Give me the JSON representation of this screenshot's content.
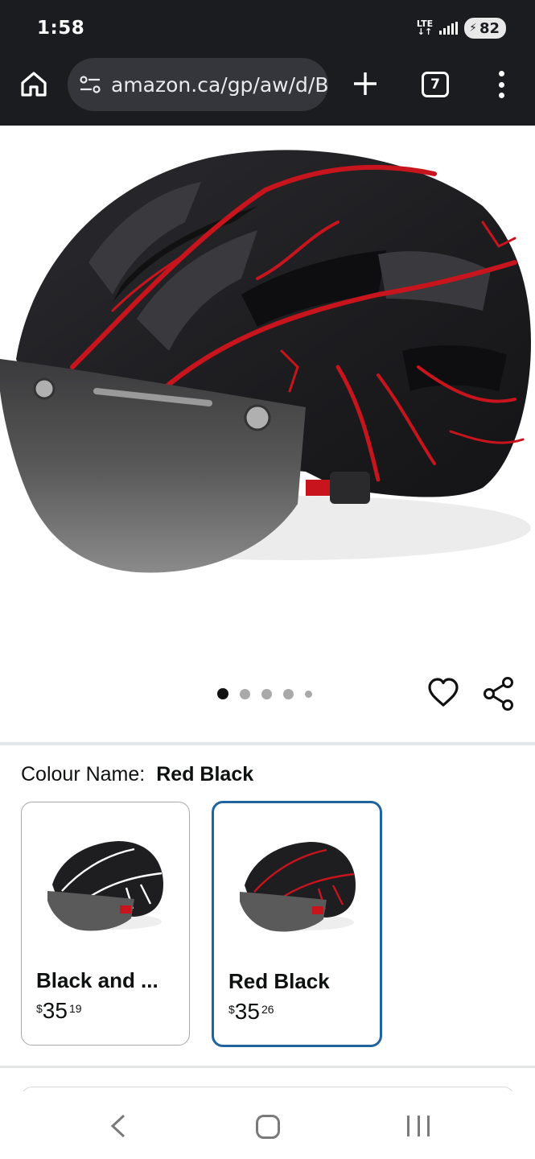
{
  "status_bar": {
    "time": "1:58",
    "network": "LTE",
    "battery": "82",
    "icons": [
      "lte-icon",
      "signal-icon",
      "battery-icon"
    ]
  },
  "browser": {
    "url": "amazon.ca/gp/aw/d/B",
    "tab_count": "7",
    "icons": [
      "home-icon",
      "site-settings-icon",
      "new-tab-icon",
      "tabs-icon",
      "more-menu-icon"
    ]
  },
  "gallery": {
    "image_count": 5,
    "active_index": 0,
    "icons": [
      "wishlist-heart-icon",
      "share-icon"
    ]
  },
  "variation": {
    "label": "Colour Name:",
    "selected": "Red Black",
    "options": [
      {
        "name": "Black and ...",
        "price_symbol": "$",
        "price_whole": "35",
        "price_fraction": "19",
        "accent": "#ffffff",
        "selected": false
      },
      {
        "name": "Red Black",
        "price_symbol": "$",
        "price_whole": "35",
        "price_fraction": "26",
        "accent": "#c8141c",
        "selected": true
      }
    ]
  },
  "colors": {
    "chrome_bg": "#1b1c20",
    "url_bar_bg": "#34363b",
    "selected_border": "#2162a1",
    "helmet_shell": "#1e1e21",
    "helmet_accent": "#c8141c"
  },
  "nav_bar": {
    "icons": [
      "back-icon",
      "home-icon",
      "recent-apps-icon"
    ]
  }
}
